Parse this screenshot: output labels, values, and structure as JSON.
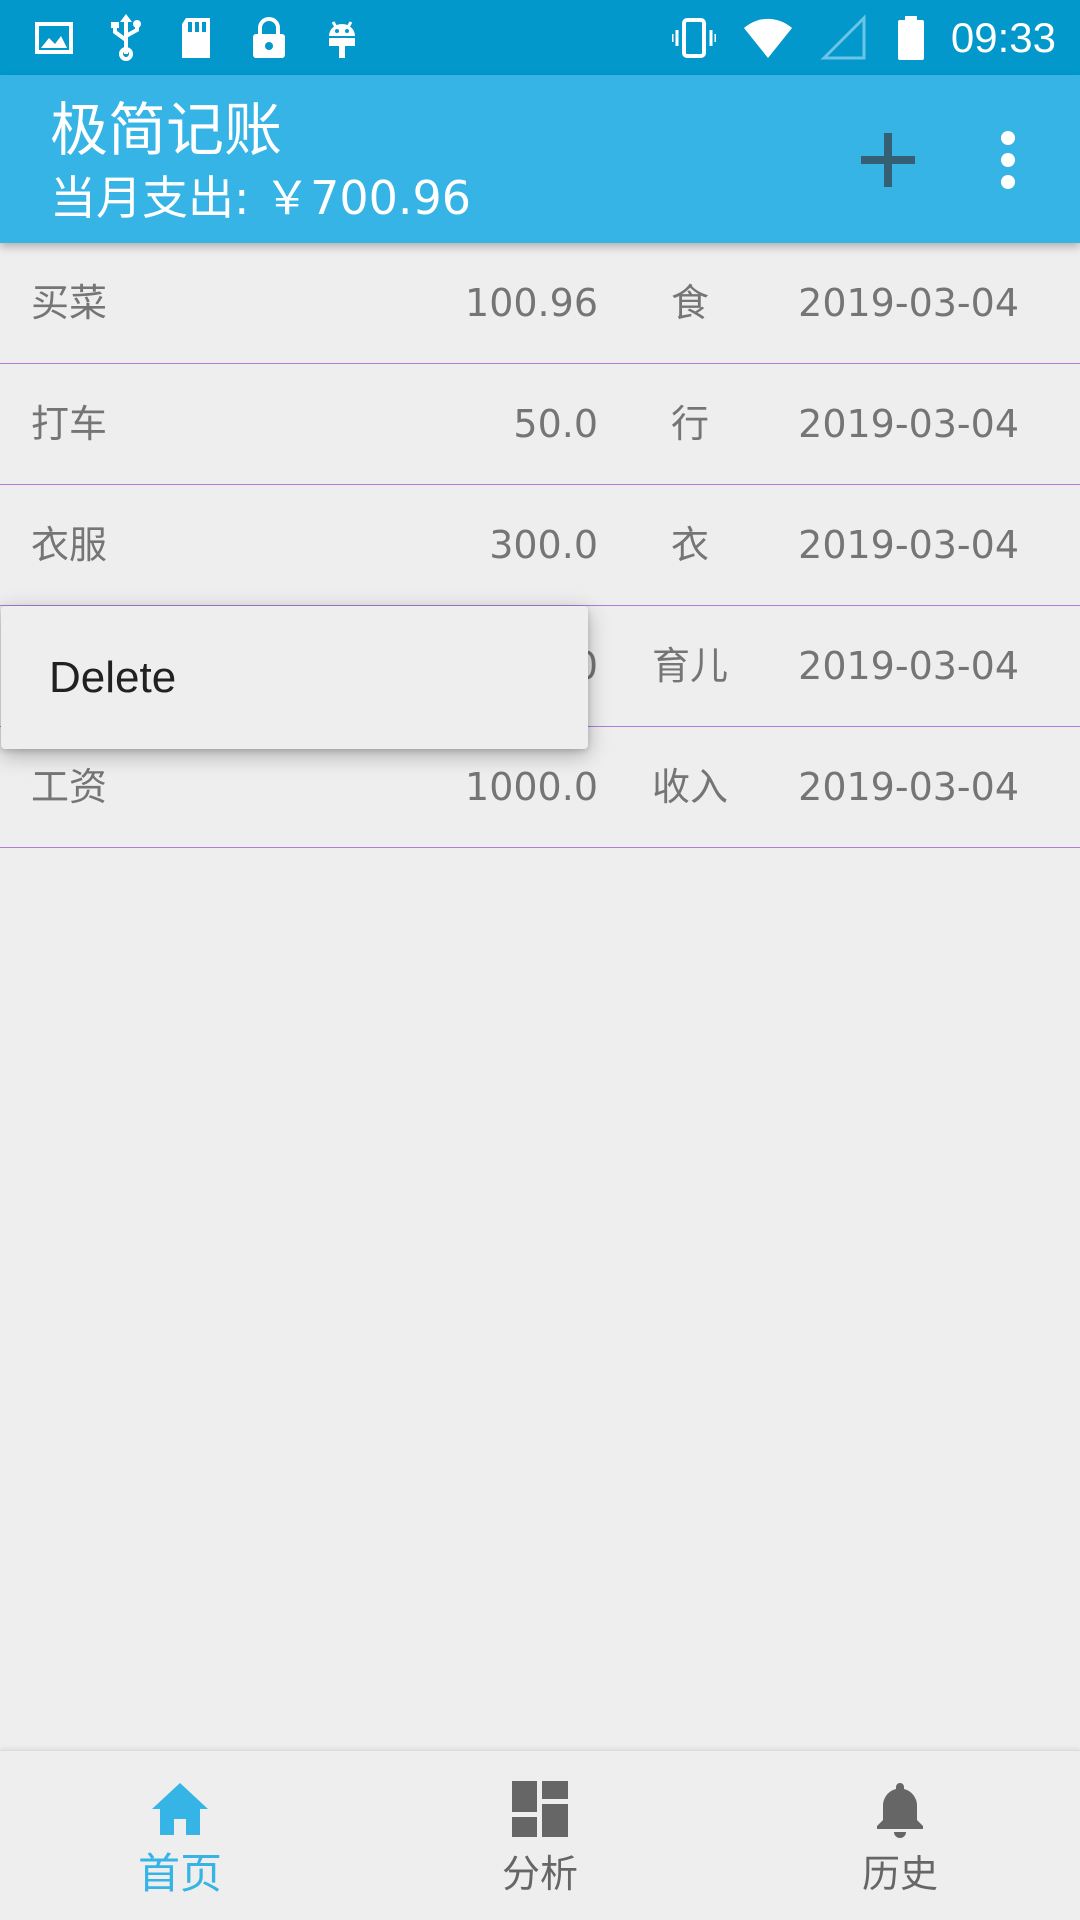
{
  "status_bar": {
    "time": "09:33",
    "icons": [
      "image-icon",
      "usb-icon",
      "sd-card-icon",
      "lock-icon",
      "android-icon",
      "vibrate-icon",
      "wifi-icon",
      "signal-icon",
      "battery-icon"
    ]
  },
  "app_bar": {
    "title": "极简记账",
    "subtitle": "当月支出: ￥700.96",
    "actions": [
      "add-icon",
      "more-vert-icon"
    ],
    "color": "#35b4e5"
  },
  "records": [
    {
      "name": "买菜",
      "amount": "100.96",
      "category": "食",
      "date": "2019-03-04"
    },
    {
      "name": "打车",
      "amount": "50.0",
      "category": "行",
      "date": "2019-03-04"
    },
    {
      "name": "衣服",
      "amount": "300.0",
      "category": "衣",
      "date": "2019-03-04"
    },
    {
      "name": "",
      "amount": "0",
      "category": "育儿",
      "date": "2019-03-04"
    },
    {
      "name": "工资",
      "amount": "1000.0",
      "category": "收入",
      "date": "2019-03-04"
    }
  ],
  "context_menu": {
    "items": [
      {
        "label": "Delete"
      }
    ]
  },
  "bottom_nav": {
    "items": [
      {
        "label": "首页",
        "icon": "home-icon",
        "active": true
      },
      {
        "label": "分析",
        "icon": "dashboard-icon",
        "active": false
      },
      {
        "label": "历史",
        "icon": "bell-icon",
        "active": false
      }
    ],
    "active_color": "#35b4e5"
  }
}
